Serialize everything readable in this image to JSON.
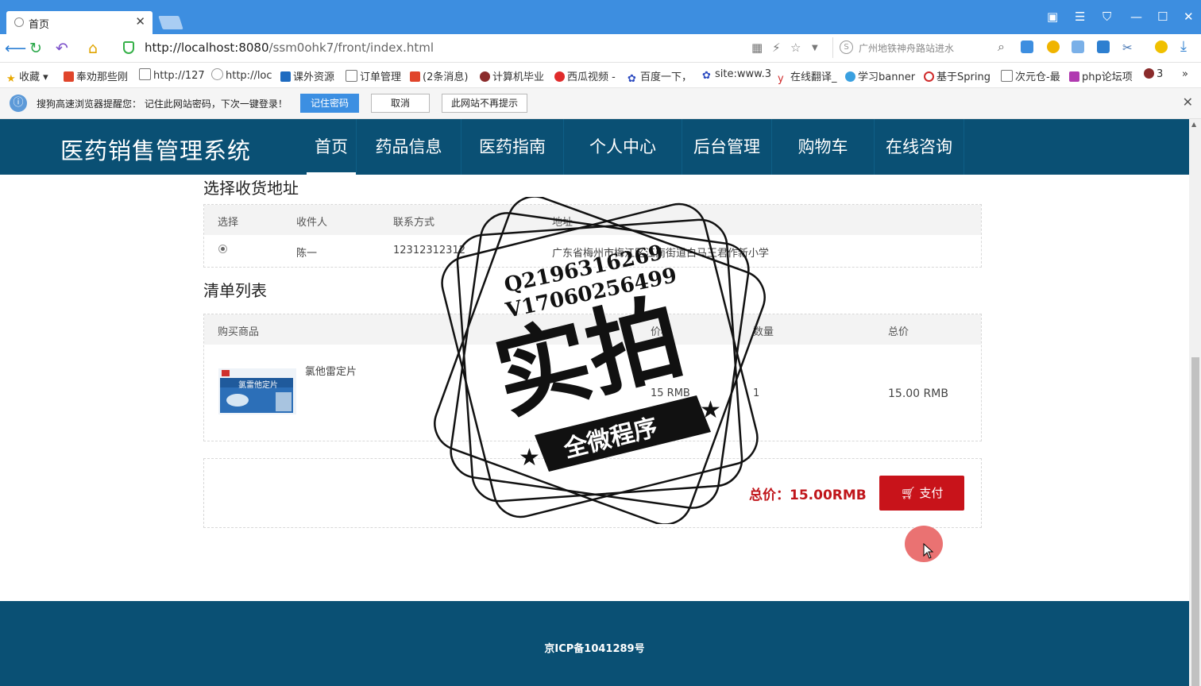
{
  "browser": {
    "tab_title": "首页",
    "url_host": "http://localhost:8080",
    "url_path": "/ssm0ohk7/front/index.html",
    "search_placeholder": "广州地铁神舟路站进水",
    "bookmarks": [
      "收藏",
      "奉劝那些刚",
      "http://127",
      "http://loc",
      "课外资源",
      "订单管理",
      "(2条消息)",
      "计算机毕业",
      "西瓜视频 -",
      "百度一下，",
      "site:www.3",
      "在线翻译_",
      "学习banner",
      "基于Spring",
      "次元仓-最",
      "php论坛项",
      "3"
    ],
    "notice": {
      "message": "搜狗高速浏览器提醒您： 记住此网站密码，下次一键登录！",
      "remember_label": "记住密码",
      "cancel_label": "取消",
      "never_label": "此网站不再提示"
    }
  },
  "site": {
    "logo": "医药销售管理系统",
    "nav": [
      "首页",
      "药品信息",
      "医药指南",
      "个人中心",
      "后台管理",
      "购物车",
      "在线咨询"
    ],
    "active_nav": "首页"
  },
  "address_section": {
    "title": "选择收货地址",
    "headers": [
      "选择",
      "收件人",
      "联系方式",
      "地址"
    ],
    "rows": [
      {
        "selected": true,
        "recipient": "陈一",
        "phone": "12312312312",
        "address": "广东省梅州市梅江区江南街道白马王君作新小学"
      }
    ]
  },
  "list_section": {
    "title": "清单列表",
    "headers": [
      "购买商品",
      "价格",
      "数量",
      "总价"
    ],
    "rows": [
      {
        "name": "氯他雷定片",
        "image_text": "氯雷他定片",
        "price": "15 RMB",
        "quantity": "1",
        "total": "15.00 RMB"
      }
    ]
  },
  "payment": {
    "total_label": "总价：15.00RMB",
    "pay_label": "支付"
  },
  "footer": {
    "icp": "京ICP备1041289号"
  },
  "watermark": {
    "line1": "Q2196316269",
    "line2": "V17060256499",
    "main": "实拍",
    "banner": "全微程序"
  },
  "colors": {
    "header_bg": "#0a5074",
    "pay_red": "#c8131a",
    "browser_blue": "#3d8ee0"
  }
}
